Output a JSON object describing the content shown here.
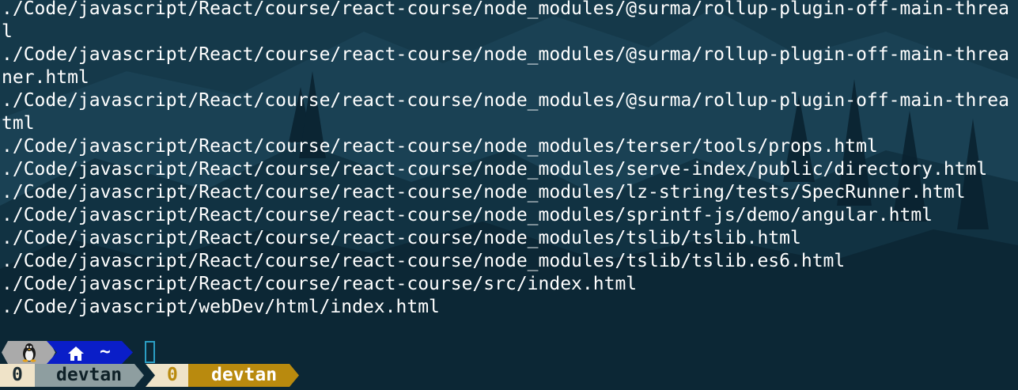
{
  "terminal": {
    "output_lines": [
      "./Code/javascript/React/course/react-course/node_modules/@surma/rollup-plugin-off-main-threa",
      "l",
      "./Code/javascript/React/course/react-course/node_modules/@surma/rollup-plugin-off-main-threa",
      "ner.html",
      "./Code/javascript/React/course/react-course/node_modules/@surma/rollup-plugin-off-main-threa",
      "tml",
      "./Code/javascript/React/course/react-course/node_modules/terser/tools/props.html",
      "./Code/javascript/React/course/react-course/node_modules/serve-index/public/directory.html",
      "./Code/javascript/React/course/react-course/node_modules/lz-string/tests/SpecRunner.html",
      "./Code/javascript/React/course/react-course/node_modules/sprintf-js/demo/angular.html",
      "./Code/javascript/React/course/react-course/node_modules/tslib/tslib.html",
      "./Code/javascript/React/course/react-course/node_modules/tslib/tslib.es6.html",
      "./Code/javascript/React/course/react-course/src/index.html",
      "./Code/javascript/webDev/html/index.html"
    ]
  },
  "prompt": {
    "os_icon": "tux-penguin-icon",
    "home_icon": "home-icon",
    "dir": "~",
    "status_left_index": "0",
    "status_left_name": "devtan",
    "status_right_index": "0",
    "status_right_name": "devtan"
  },
  "colors": {
    "background": "#123645",
    "text": "#ffffff",
    "segment_os": "#aaaaaa",
    "segment_dir": "#0a1ec8",
    "status_index_bg": "#efe3c8",
    "status_name_bg": "#8e9ea0",
    "status_name_active_bg": "#b98a0e",
    "status_index_active_fg": "#b98a0e",
    "cursor": "#2b9ec4"
  }
}
